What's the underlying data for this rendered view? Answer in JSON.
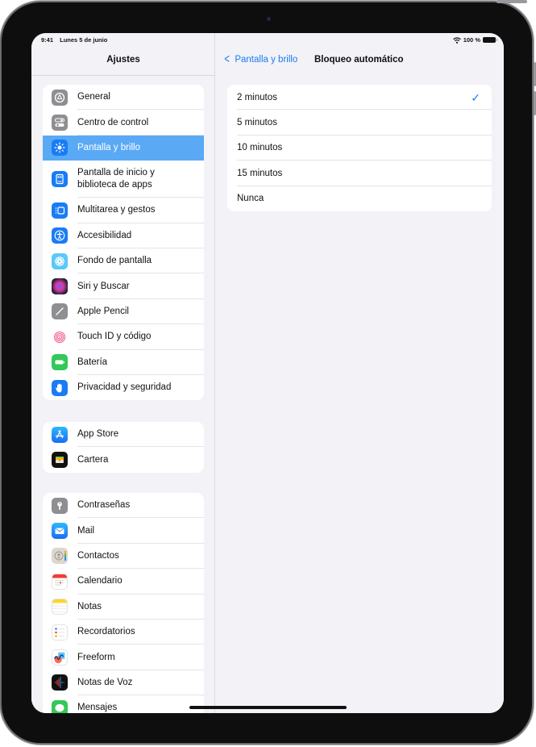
{
  "status_bar": {
    "time": "9:41",
    "date": "Lunes 5 de junio",
    "battery": "100 %"
  },
  "sidebar": {
    "title": "Ajustes",
    "groups": [
      {
        "items": [
          {
            "label": "General",
            "icon": "gear-icon",
            "color": "#8e8e93"
          },
          {
            "label": "Centro de control",
            "icon": "toggles-icon",
            "color": "#8e8e93"
          },
          {
            "label": "Pantalla y brillo",
            "icon": "sun-icon",
            "color": "#1a7cf5",
            "selected": true
          },
          {
            "label": "Pantalla de inicio y biblioteca de apps",
            "icon": "home-screen-icon",
            "color": "#1a7cf5"
          },
          {
            "label": "Multitarea y gestos",
            "icon": "multitask-icon",
            "color": "#1a7cf5"
          },
          {
            "label": "Accesibilidad",
            "icon": "accessibility-icon",
            "color": "#1a7cf5"
          },
          {
            "label": "Fondo de pantalla",
            "icon": "wallpaper-flower-icon",
            "color": "#5ac8fa"
          },
          {
            "label": "Siri y Buscar",
            "icon": "siri-icon",
            "color": "#222233"
          },
          {
            "label": "Apple Pencil",
            "icon": "pencil-icon",
            "color": "#8e8e93"
          },
          {
            "label": "Touch ID y código",
            "icon": "fingerprint-icon",
            "color": "#ffffff"
          },
          {
            "label": "Batería",
            "icon": "battery-icon",
            "color": "#34c759"
          },
          {
            "label": "Privacidad y seguridad",
            "icon": "hand-icon",
            "color": "#1a7cf5"
          }
        ]
      },
      {
        "items": [
          {
            "label": "App Store",
            "icon": "app-store-icon",
            "color": "#1a8cf5"
          },
          {
            "label": "Cartera",
            "icon": "wallet-icon",
            "color": "#111111"
          }
        ]
      },
      {
        "items": [
          {
            "label": "Contraseñas",
            "icon": "key-icon",
            "color": "#8e8e93"
          },
          {
            "label": "Mail",
            "icon": "mail-icon",
            "color": "#1a8cf5"
          },
          {
            "label": "Contactos",
            "icon": "contacts-icon",
            "color": "#d8d5cf"
          },
          {
            "label": "Calendario",
            "icon": "calendar-icon",
            "color": "#ffffff"
          },
          {
            "label": "Notas",
            "icon": "notes-icon",
            "color": "#ffffff"
          },
          {
            "label": "Recordatorios",
            "icon": "reminders-icon",
            "color": "#ffffff"
          },
          {
            "label": "Freeform",
            "icon": "freeform-icon",
            "color": "#ffffff"
          },
          {
            "label": "Notas de Voz",
            "icon": "voice-memos-icon",
            "color": "#111111"
          },
          {
            "label": "Mensajes",
            "icon": "messages-icon",
            "color": "#34c759"
          }
        ]
      }
    ]
  },
  "detail": {
    "back_label": "Pantalla y brillo",
    "title": "Bloqueo automático",
    "options": [
      {
        "label": "2 minutos",
        "checked": true
      },
      {
        "label": "5 minutos",
        "checked": false
      },
      {
        "label": "10 minutos",
        "checked": false
      },
      {
        "label": "15 minutos",
        "checked": false
      },
      {
        "label": "Nunca",
        "checked": false
      }
    ],
    "check_glyph": "✓"
  },
  "colors": {
    "accent": "#1c7cf2",
    "selected_row": "#5aa9f5"
  }
}
